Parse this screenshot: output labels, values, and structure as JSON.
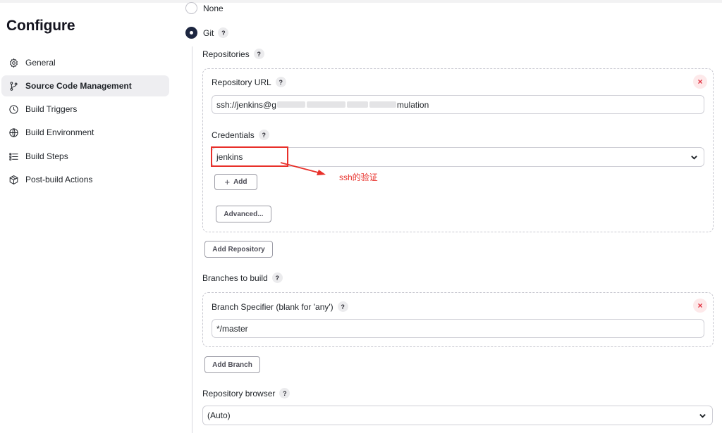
{
  "sidebar": {
    "title": "Configure",
    "items": [
      {
        "label": "General",
        "icon": "gear-icon",
        "active": false
      },
      {
        "label": "Source Code Management",
        "icon": "branch-icon",
        "active": true
      },
      {
        "label": "Build Triggers",
        "icon": "clock-icon",
        "active": false
      },
      {
        "label": "Build Environment",
        "icon": "globe-icon",
        "active": false
      },
      {
        "label": "Build Steps",
        "icon": "list-icon",
        "active": false
      },
      {
        "label": "Post-build Actions",
        "icon": "package-icon",
        "active": false
      }
    ]
  },
  "scm": {
    "option_none": "None",
    "option_git": "Git",
    "help": "?",
    "repositories_label": "Repositories",
    "repository_url_label": "Repository URL",
    "repository_url_prefix": "ssh://jenkins@g",
    "repository_url_suffix": "mulation",
    "credentials_label": "Credentials",
    "credentials_value": "jenkins",
    "add_button": "Add",
    "advanced_button": "Advanced...",
    "add_repository_button": "Add Repository",
    "branches_label": "Branches to build",
    "branch_specifier_label": "Branch Specifier (blank for 'any')",
    "branch_specifier_value": "*/master",
    "add_branch_button": "Add Branch",
    "repository_browser_label": "Repository browser",
    "repository_browser_value": "(Auto)",
    "close_symbol": "×"
  },
  "annotation": {
    "text": "ssh的验证",
    "color": "#e8302a"
  },
  "colors": {
    "radio_checked": "#1d2640",
    "active_nav_bg": "#eeeef1",
    "close_bg": "#fde9ea",
    "close_fg": "#e0303f"
  }
}
